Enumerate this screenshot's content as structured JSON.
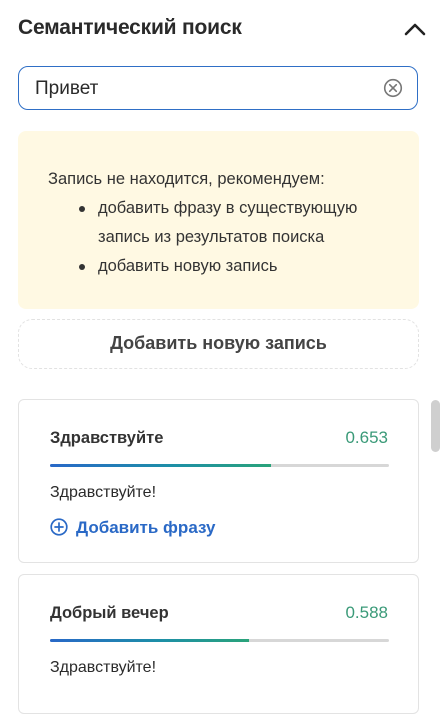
{
  "header": {
    "title": "Семантический поиск",
    "collapse_icon": "chevron-up-icon"
  },
  "search": {
    "value": "Привет",
    "clear_icon": "clear-circle-icon"
  },
  "notice": {
    "intro": "Запись не находится, рекомендуем:",
    "items": [
      "добавить фразу в существующую запись из результатов поиска",
      "добавить новую запись"
    ],
    "items_display": [
      [
        "добавить фразу в существующую",
        "запись из результатов поиска"
      ],
      [
        "добавить новую запись"
      ]
    ]
  },
  "add_new_button": {
    "label": "Добавить новую запись"
  },
  "results": [
    {
      "title": "Здравствуйте",
      "score": "0.653",
      "phrase": "Здравствуйте!",
      "action": "Добавить фразу"
    },
    {
      "title": "Добрый вечер",
      "score": "0.588",
      "phrase": "Здравствуйте!"
    }
  ],
  "colors": {
    "accent": "#2f6fc6",
    "score": "#3a9a78",
    "notice_bg": "#fff9e3"
  }
}
